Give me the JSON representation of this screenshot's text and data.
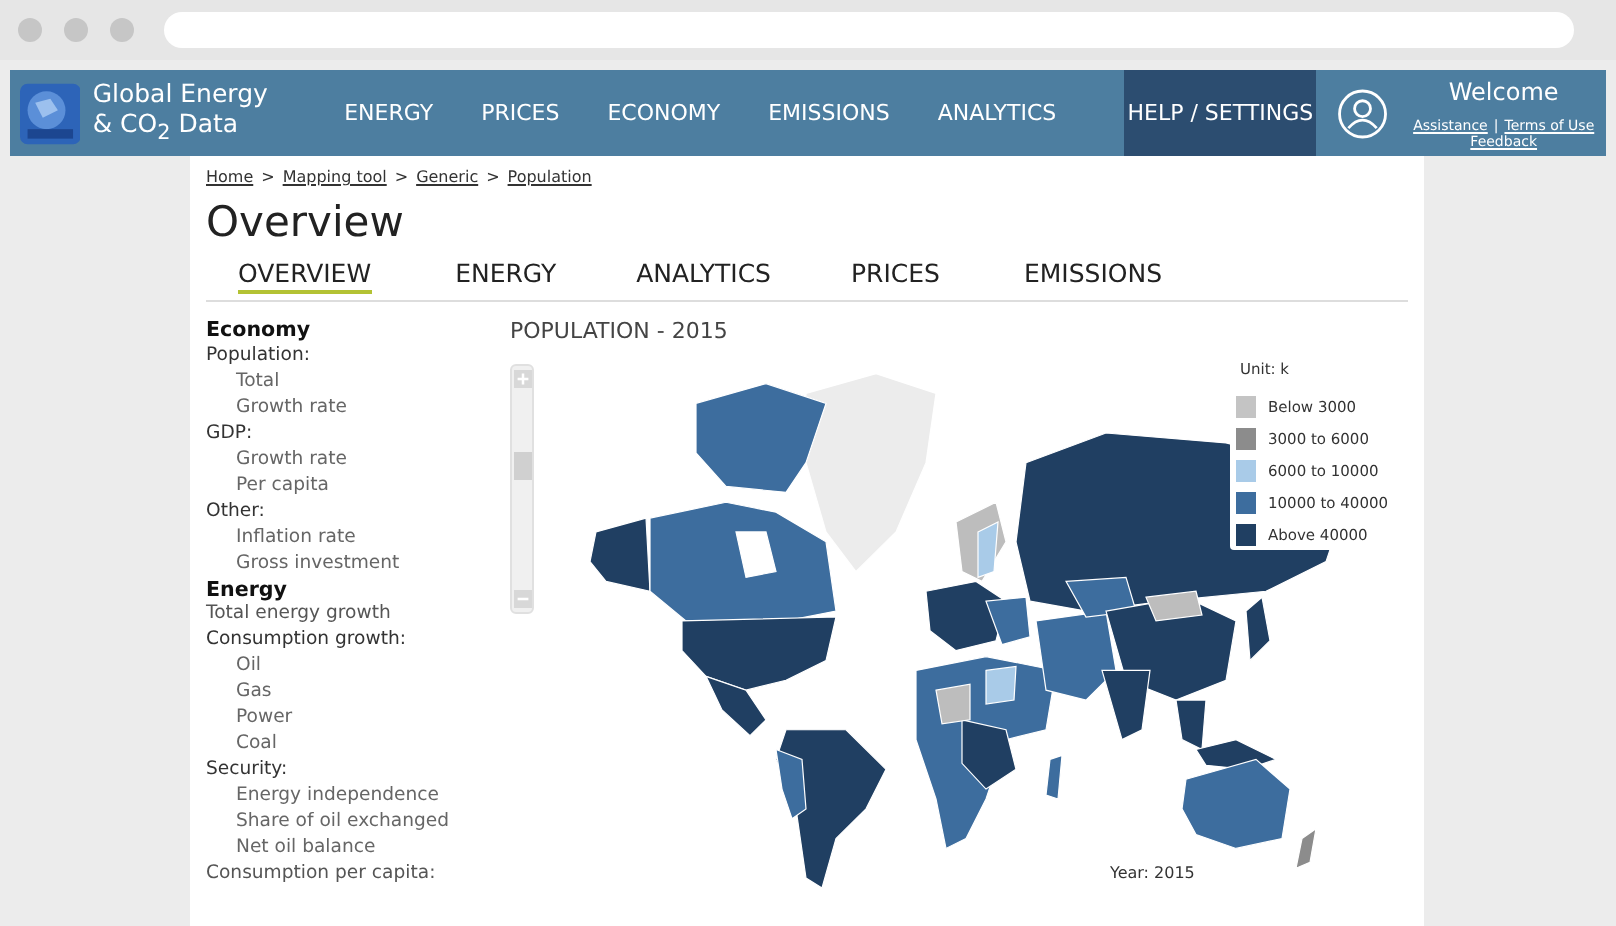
{
  "header": {
    "logo_lines": [
      "Global Energy",
      "& CO$_{2}$ Data"
    ],
    "nav": [
      {
        "label": "ENERGY",
        "selected": false
      },
      {
        "label": "PRICES",
        "selected": false
      },
      {
        "label": "ECONOMY",
        "selected": false
      },
      {
        "label": "EMISSIONS",
        "selected": false
      },
      {
        "label": "ANALYTICS",
        "selected": false
      },
      {
        "label": "HELP / SETTINGS",
        "selected": true
      }
    ],
    "welcome": "Welcome",
    "links": [
      "Assistance",
      "Terms of Use"
    ],
    "separator": "|",
    "feedback": "Feedback"
  },
  "breadcrumb": {
    "items": [
      "Home",
      "Mapping tool",
      "Generic",
      "Population"
    ],
    "separator": ">"
  },
  "page_title": "Overview",
  "tabs": [
    {
      "label": "OVERVIEW",
      "selected": true
    },
    {
      "label": "ENERGY",
      "selected": false
    },
    {
      "label": "ANALYTICS",
      "selected": false
    },
    {
      "label": "PRICES",
      "selected": false
    },
    {
      "label": "EMISSIONS",
      "selected": false
    }
  ],
  "sidebar": [
    {
      "title": "Economy",
      "items": [
        {
          "label": "Population:",
          "children": [
            {
              "label": "Total"
            },
            {
              "label": "Growth rate"
            }
          ]
        },
        {
          "label": "GDP:",
          "children": [
            {
              "label": "Growth rate"
            },
            {
              "label": "Per capita"
            }
          ]
        },
        {
          "label": "Other:",
          "children": [
            {
              "label": "Inflation rate"
            },
            {
              "label": "Gross investment"
            }
          ]
        }
      ]
    },
    {
      "title": "Energy",
      "items": [
        {
          "label": "Total energy growth"
        },
        {
          "label": "Consumption growth:",
          "children": [
            {
              "label": "Oil"
            },
            {
              "label": "Gas"
            },
            {
              "label": "Power"
            },
            {
              "label": "Coal"
            }
          ]
        },
        {
          "label": "Security:",
          "children": [
            {
              "label": "Energy independence"
            },
            {
              "label": "Share of oil exchanged"
            },
            {
              "label": "Net oil balance"
            }
          ]
        },
        {
          "label": "Consumption per capita:"
        }
      ]
    }
  ],
  "map": {
    "title": "POPULATION - 2015",
    "unit": "Unit: k",
    "year": "Year: 2015",
    "zoom": {
      "level": 0.62
    },
    "legend": [
      {
        "label": "Below 3000",
        "color": "#c4c4c4"
      },
      {
        "label": "3000 to 6000",
        "color": "#8c8c8c"
      },
      {
        "label": "6000 to 10000",
        "color": "#a9cbe8"
      },
      {
        "label": "10000 to 40000",
        "color": "#3d6d9e"
      },
      {
        "label": "Above 40000",
        "color": "#203f62"
      }
    ]
  }
}
